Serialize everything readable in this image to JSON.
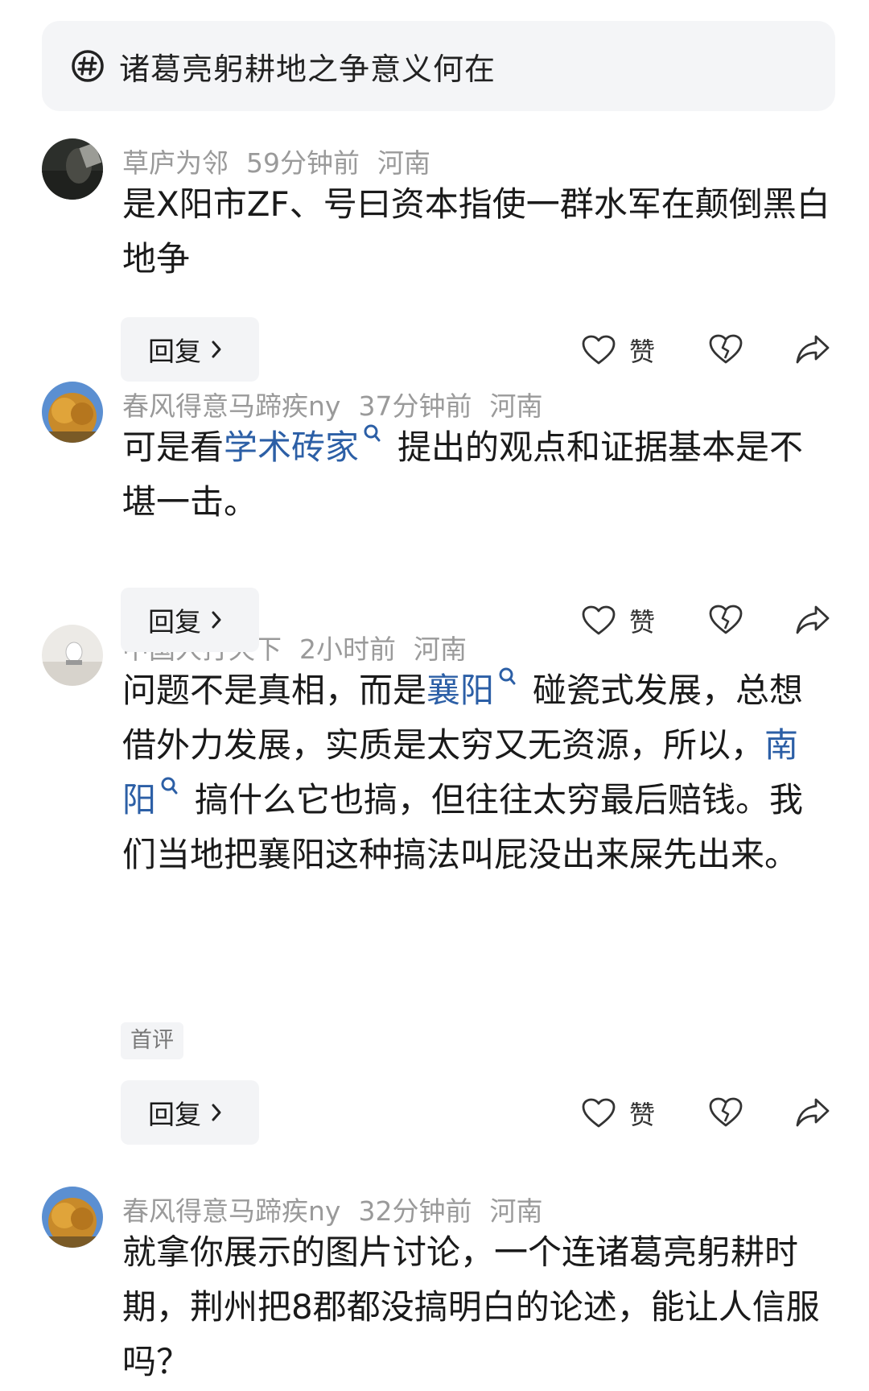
{
  "topic": {
    "title": "诸葛亮躬耕地之争意义何在",
    "icon": "hashtag-icon"
  },
  "actions": {
    "reply_label": "回复",
    "like_label": "赞"
  },
  "comments": [
    {
      "user": "草庐为邻",
      "time": "59分钟前",
      "location": "河南",
      "text_parts": [
        "是X阳市ZF、号曰资本指使一群水军在颠倒黑白地争"
      ]
    },
    {
      "user": "春风得意马蹄疾ny",
      "time": "37分钟前",
      "location": "河南",
      "text_parts": [
        "可是看",
        "学术砖家",
        "提出的观点和证据基本是不堪一击。"
      ]
    },
    {
      "user": "中国人打天下",
      "time": "2小时前",
      "location": "河南",
      "text_parts": [
        "问题不是真相，而是",
        "襄阳",
        "碰瓷式发展，总想借外力发展，实质是太穷又无资源，所以，",
        "南阳",
        "搞什么它也搞，但往往太穷最后赔钱。我们当地把襄阳这种搞法叫屁没出来屎先出来。"
      ],
      "badge": "首评"
    },
    {
      "user": "春风得意马蹄疾ny",
      "time": "32分钟前",
      "location": "河南",
      "text_parts": [
        "就拿你展示的图片讨论，一个连诸葛亮躬耕时期，荆州把8郡都没搞明白的论述，能让人信服吗？"
      ]
    }
  ]
}
